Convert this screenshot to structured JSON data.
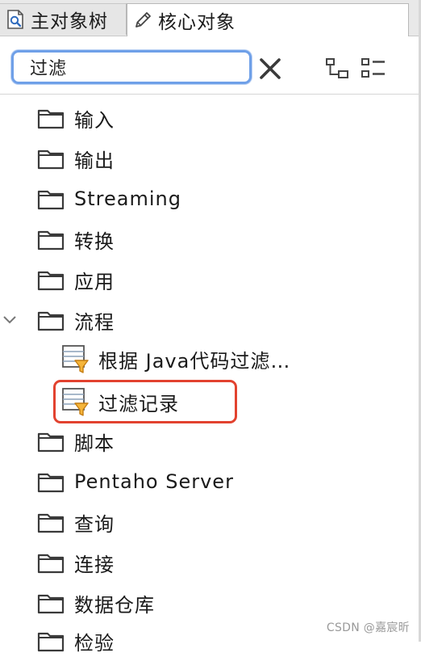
{
  "tabs": [
    {
      "label": "主对象树",
      "icon": "search-tree-icon",
      "active": false
    },
    {
      "label": "核心对象",
      "icon": "pencil-icon",
      "active": true
    }
  ],
  "search": {
    "value": "过滤",
    "placeholder": ""
  },
  "toolbar": {
    "clear_icon": "close-icon",
    "tree_icon": "tree-view-icon",
    "list_icon": "list-view-icon"
  },
  "tree": {
    "folders_top": [
      {
        "label": "输入"
      },
      {
        "label": "输出"
      },
      {
        "label": "Streaming"
      },
      {
        "label": "转换"
      },
      {
        "label": "应用"
      }
    ],
    "expanded_folder": {
      "label": "流程",
      "expanded": true
    },
    "steps": [
      {
        "label": "根据 Java代码过滤…"
      },
      {
        "label": "过滤记录",
        "highlighted": true
      }
    ],
    "folders_bottom": [
      {
        "label": "脚本"
      },
      {
        "label": "Pentaho Server"
      },
      {
        "label": "查询"
      },
      {
        "label": "连接"
      },
      {
        "label": "数据仓库"
      },
      {
        "label": "检验"
      }
    ]
  },
  "colors": {
    "focus": "#6fa0e8",
    "highlight": "#e2422f",
    "funnel": "#f5b53a"
  },
  "watermark": "CSDN @嘉宸昕"
}
